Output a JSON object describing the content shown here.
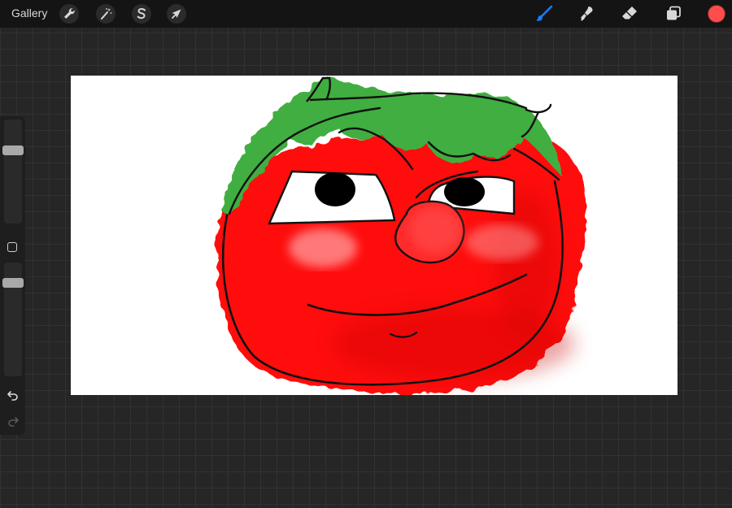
{
  "topbar": {
    "gallery_label": "Gallery",
    "left_tools": [
      {
        "name": "actions",
        "icon": "wrench-icon"
      },
      {
        "name": "adjustments",
        "icon": "magic-wand-icon"
      },
      {
        "name": "selection",
        "icon": "selection-s-icon"
      },
      {
        "name": "transform",
        "icon": "arrow-cursor-icon"
      }
    ],
    "right_tools": [
      {
        "name": "brush",
        "icon": "brush-icon",
        "active": true
      },
      {
        "name": "smudge",
        "icon": "smudge-icon"
      },
      {
        "name": "eraser",
        "icon": "eraser-icon"
      },
      {
        "name": "layers",
        "icon": "layers-icon"
      }
    ],
    "current_color": "#ff4c4c"
  },
  "sidebar": {
    "brush_size_level": 0.72,
    "opacity_level": 0.85,
    "undo_icon": "undo-icon",
    "redo_icon": "redo-icon",
    "modify_icon": "square-icon"
  },
  "colors": {
    "accent_blue": "#1a7cf5",
    "tomato_red": "#ff1111",
    "leaf_green": "#3fae3f"
  }
}
